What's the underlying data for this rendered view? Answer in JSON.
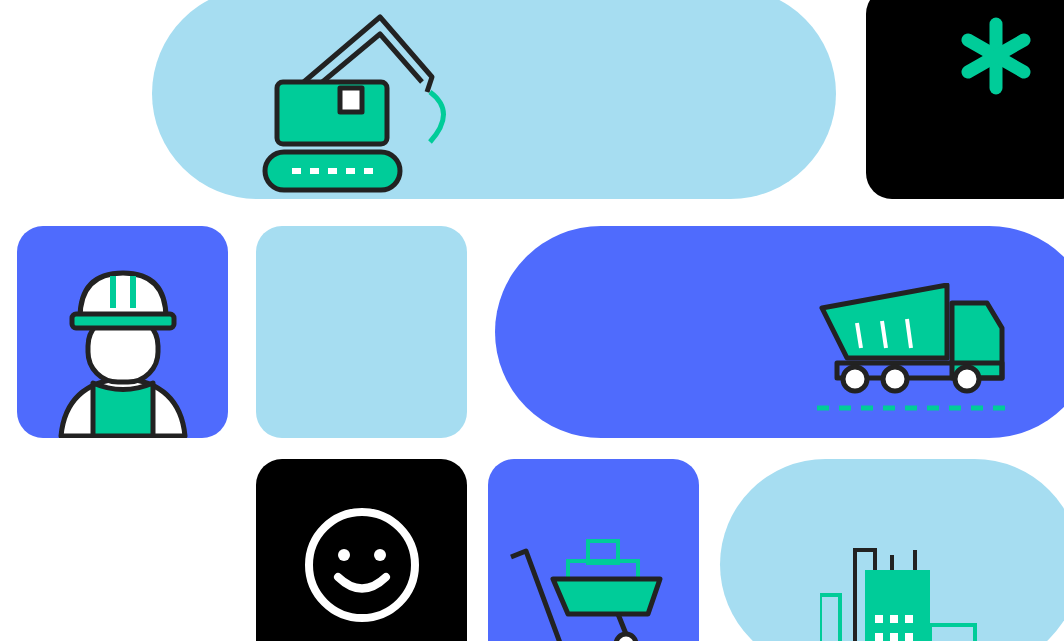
{
  "rows": [
    {
      "tiles": [
        {
          "kind": "excavator",
          "color": "#a6ddf1"
        },
        {
          "kind": "asterisk",
          "color": "#000000"
        }
      ]
    },
    {
      "tiles": [
        {
          "kind": "worker",
          "color": "#4f6bfd"
        },
        {
          "kind": "blank",
          "color": "#a6ddf1"
        },
        {
          "kind": "dump-truck",
          "color": "#4f6bfd"
        }
      ]
    },
    {
      "tiles": [
        {
          "kind": "smiley",
          "color": "#000000"
        },
        {
          "kind": "cart",
          "color": "#4f6bfd"
        },
        {
          "kind": "building",
          "color": "#a6ddf1"
        }
      ]
    }
  ]
}
